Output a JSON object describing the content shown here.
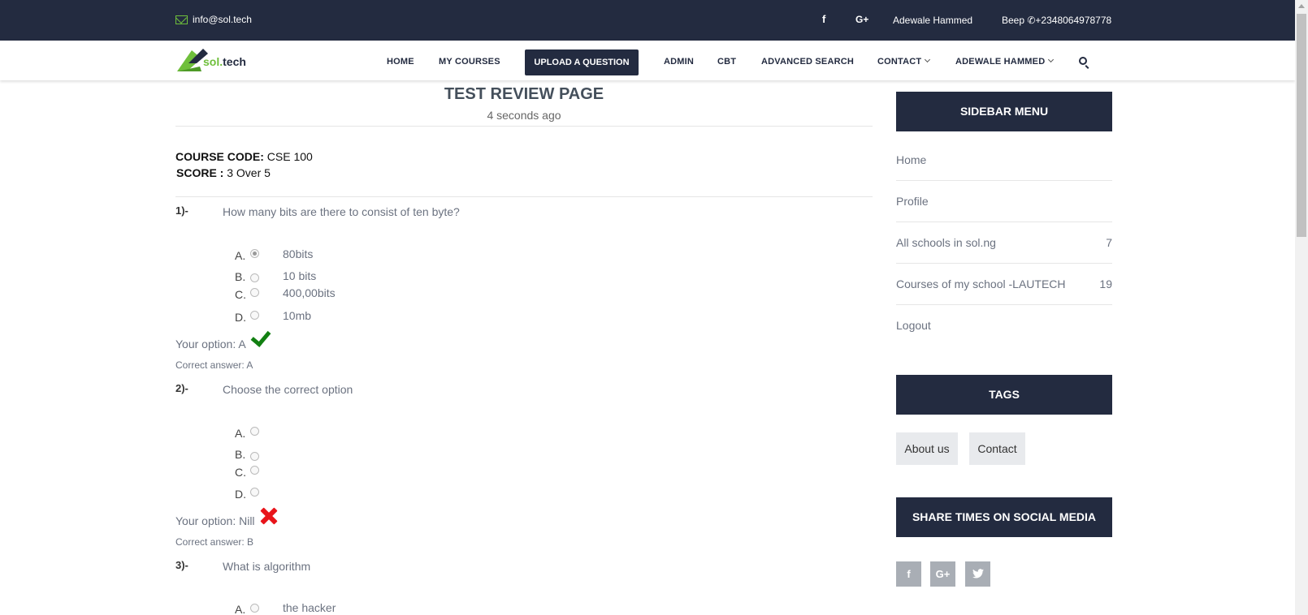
{
  "topbar": {
    "email": "info@sol.tech",
    "facebook_glyph": "f",
    "googleplus_glyph": "G+",
    "user_name": "Adewale Hammed",
    "phone": "Beep ✆+2348064978778"
  },
  "brand": {
    "name_prefix": "sol.",
    "name_suffix": "tech"
  },
  "nav": {
    "home": "HOME",
    "my_courses": "MY COURSES",
    "upload": "UPLOAD A QUESTION",
    "admin": "ADMIN",
    "cbt": "CBT",
    "advanced_search": "ADVANCED SEARCH",
    "contact": "CONTACT",
    "user": "ADEWALE HAMMED"
  },
  "main": {
    "title": "TEST REVIEW PAGE",
    "subtitle": "4 seconds ago",
    "course_label": "COURSE CODE:",
    "course_value": " CSE 100",
    "score_label": "SCORE :",
    "score_value": " 3 Over 5"
  },
  "questions": [
    {
      "num": "1)-",
      "text": "How many bits are there to consist of ten byte?",
      "options": [
        {
          "letter": "A.",
          "text": "80bits",
          "selected": true
        },
        {
          "letter": "B.",
          "text": "10 bits",
          "selected": false
        },
        {
          "letter": "C.",
          "text": "400,00bits",
          "selected": false
        },
        {
          "letter": "D.",
          "text": "10mb",
          "selected": false
        }
      ],
      "your_option": "Your option: A",
      "result": "correct",
      "correct_answer": "Correct answer: A"
    },
    {
      "num": "2)-",
      "text": "Choose the correct option",
      "options": [
        {
          "letter": "A.",
          "text": "",
          "selected": false
        },
        {
          "letter": "B.",
          "text": "",
          "selected": false
        },
        {
          "letter": "C.",
          "text": "",
          "selected": false
        },
        {
          "letter": "D.",
          "text": "",
          "selected": false
        }
      ],
      "your_option": "Your option: Nill",
      "result": "wrong",
      "correct_answer": "Correct answer: B"
    },
    {
      "num": "3)-",
      "text": "What is algorithm",
      "options": [
        {
          "letter": "A.",
          "text": "the hacker",
          "selected": false
        }
      ]
    }
  ],
  "sidebar": {
    "menu_title": "SIDEBAR MENU",
    "items": [
      {
        "label": "Home",
        "count": ""
      },
      {
        "label": "Profile",
        "count": ""
      },
      {
        "label": "All schools in sol.ng",
        "count": "7"
      },
      {
        "label": "Courses of my school -LAUTECH",
        "count": "19"
      },
      {
        "label": "Logout",
        "count": ""
      }
    ],
    "tags_title": "TAGS",
    "tags": [
      "About us",
      "Contact"
    ],
    "share_title": "SHARE TIMES ON SOCIAL MEDIA",
    "social": [
      "f",
      "G+",
      "t"
    ]
  },
  "colors": {
    "topbar_bg": "#232b40",
    "brand_green": "#6fbf3b",
    "check_green": "#128012",
    "cross_red": "#e8141a"
  },
  "icons": [
    "envelope-icon",
    "facebook-icon",
    "google-plus-icon",
    "phone-icon",
    "search-icon",
    "checkmark-icon",
    "cross-icon",
    "twitter-icon"
  ]
}
